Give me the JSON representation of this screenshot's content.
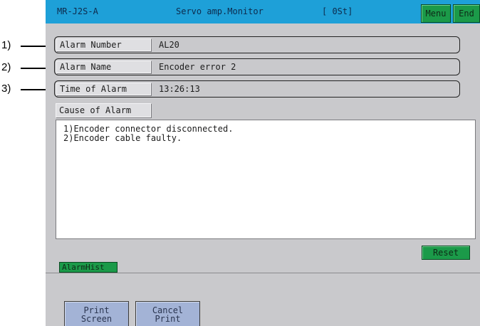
{
  "titlebar": {
    "model": "MR-J2S-A",
    "screen_title": "Servo amp.Monitor",
    "station": "[ 0St]",
    "menu_label": "Menu",
    "end_label": "End"
  },
  "fields": [
    {
      "label": "Alarm Number",
      "value": "AL20"
    },
    {
      "label": "Alarm Name",
      "value": "Encoder error 2"
    },
    {
      "label": "Time of Alarm",
      "value": "13:26:13"
    }
  ],
  "cause": {
    "label": "Cause of Alarm",
    "lines": [
      "1)Encoder connector disconnected.",
      "2)Encoder cable faulty."
    ]
  },
  "reset_label": "Reset",
  "alarmhist_label": "AlarmHist",
  "bottom": {
    "print_screen": "Print\nScreen",
    "cancel_print": "Cancel\nPrint"
  },
  "callouts": [
    "1)",
    "2)",
    "3)"
  ],
  "colors": {
    "titlebar_bg": "#1ea0d8",
    "button_green": "#1b9a49",
    "panel_gray": "#c9c9cc",
    "bottom_button": "#a3b3d6"
  }
}
